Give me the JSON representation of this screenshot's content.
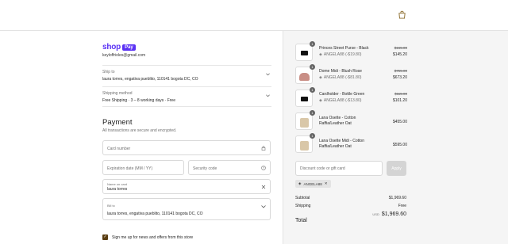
{
  "header": {
    "icon": "shopping-bag-icon"
  },
  "shop_pay": {
    "word": "shop",
    "pay": "Pay"
  },
  "account": {
    "email": "keyloffrioles@gmail.com"
  },
  "ship_to": {
    "label": "Ship to",
    "value": "laura torres, engativa pueblito, 110141 bogota DC, CO"
  },
  "shipping_method": {
    "label": "Shipping method",
    "value": "Free Shipping · 3 – 8 working days · Free"
  },
  "payment": {
    "title": "Payment",
    "subtitle": "All transactions are secure and encrypted.",
    "card_number_placeholder": "Card number",
    "expiration_placeholder": "Expiration date (MM / YY)",
    "security_placeholder": "Security code",
    "name_label": "Name on card",
    "name_value": "laura torres",
    "bill_label": "Bill to",
    "bill_value": "laura torres, engativa pueblito, 110141 bogota DC, CO"
  },
  "newsletter": {
    "label": "Sign me up for news and offers from this store",
    "checked": true
  },
  "items": [
    {
      "qty": "1",
      "name": "Princes Street Purse - Black",
      "discount": "ANGELA88 (-$19.80)",
      "old_price": "$165.00",
      "price": "$145.20",
      "thumb_color": "#111111"
    },
    {
      "qty": "1",
      "name": "Dome Midi - Blush Rose",
      "discount": "ANGELA88 (-$81.80)",
      "old_price": "$755.00",
      "price": "$673.20",
      "thumb_color": "#c98f86"
    },
    {
      "qty": "1",
      "name": "Cardholder - Bottle Green",
      "discount": "ANGELA88 (-$13.80)",
      "old_price": "$115.00",
      "price": "$101.20",
      "thumb_color": "#111111"
    },
    {
      "qty": "1",
      "name": "Lana Osette - Cotton Raffia/Leather Oat",
      "discount": "",
      "old_price": "",
      "price": "$455.00",
      "thumb_color": "#d9c7a8"
    },
    {
      "qty": "1",
      "name": "Lana Osette Midi - Cotton Raffia/Leather Oat",
      "discount": "",
      "old_price": "",
      "price": "$595.00",
      "thumb_color": "#d9c7a8"
    }
  ],
  "discount_code": {
    "placeholder": "Discount code or gift card",
    "apply": "Apply",
    "applied_code": "ANGELA88"
  },
  "summary": {
    "subtotal_label": "Subtotal",
    "subtotal_value": "$1,969.60",
    "shipping_label": "Shipping",
    "shipping_value": "Free",
    "total_label": "Total",
    "total_currency": "USD",
    "total_value": "$1,969.60"
  },
  "colors": {
    "shop_pay": "#5a31f4",
    "checkbox": "#5a3e12",
    "panel_bg": "#f5f5f5"
  }
}
